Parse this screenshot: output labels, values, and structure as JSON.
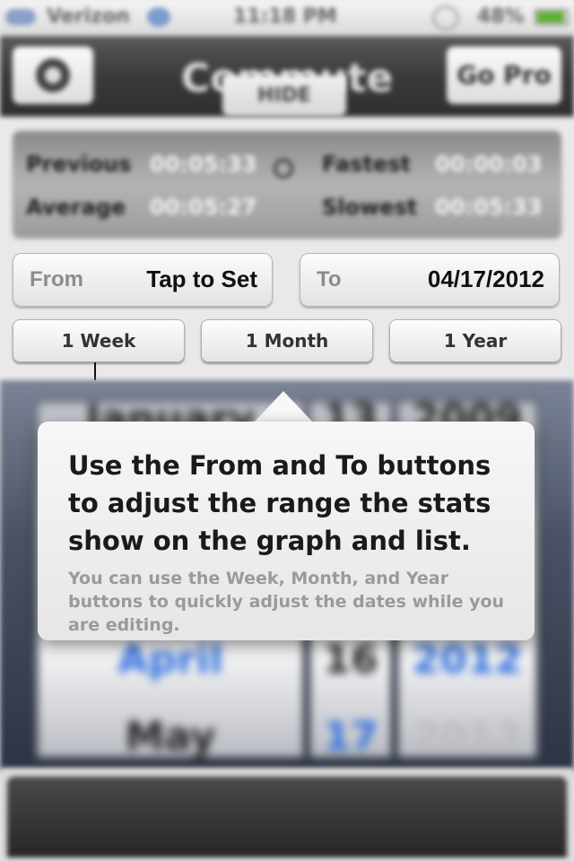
{
  "status_bar": {
    "carrier": "Verizon",
    "time": "11:18 PM",
    "battery": "48%"
  },
  "nav": {
    "title": "Commute",
    "go_pro_label": "Go Pro",
    "hide_label": "HIDE"
  },
  "stats": {
    "previous_label": "Previous",
    "previous_value": "00:05:33",
    "average_label": "Average",
    "average_value": "00:05:27",
    "fastest_label": "Fastest",
    "fastest_value": "00:00:03",
    "slowest_label": "Slowest",
    "slowest_value": "00:05:33"
  },
  "date_range": {
    "from_label": "From",
    "from_value": "Tap to Set",
    "to_label": "To",
    "to_value": "04/17/2012"
  },
  "range_buttons": [
    "1 Week",
    "1 Month",
    "1 Year"
  ],
  "picker": {
    "month_top": "January",
    "day_top": "13",
    "year_top": "2009",
    "month_selected": "April",
    "day_selected": "16",
    "year_selected": "2012",
    "month_next": "May",
    "day_next": "17",
    "year_next": "2013"
  },
  "popover": {
    "headline": "Use the From and To buttons to adjust the range the stats show on the graph and list.",
    "subtext": "You can use the Week, Month, and Year buttons to quickly adjust the dates while you are editing."
  }
}
